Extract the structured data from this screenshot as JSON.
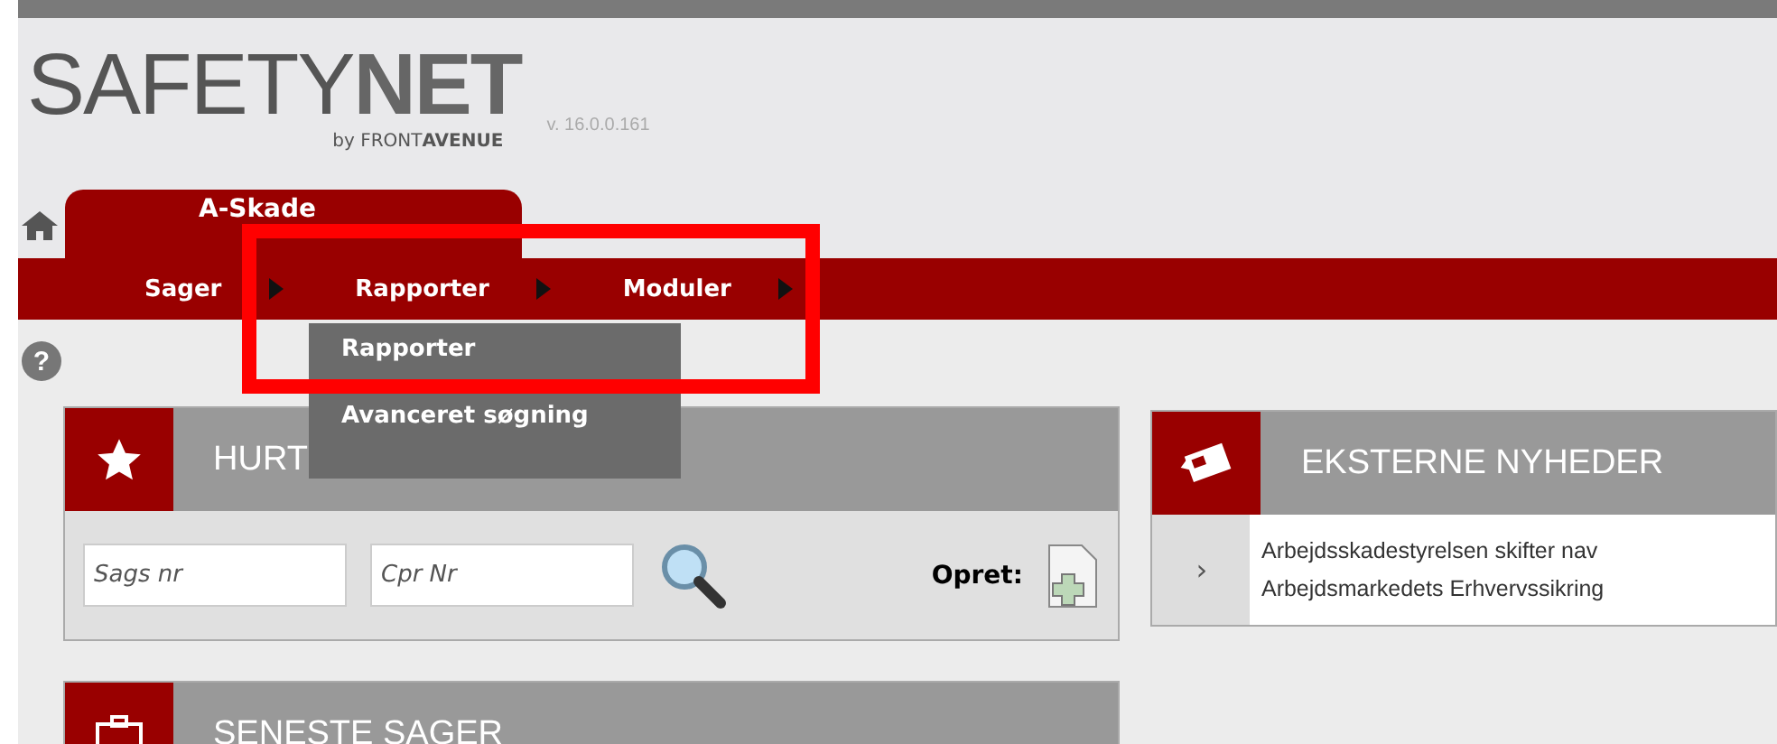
{
  "header": {
    "logo_light": "SAFETY",
    "logo_bold": "NET",
    "version": "v. 16.0.0.161",
    "byline_light": "by FRONT",
    "byline_bold": "AVENUE"
  },
  "tabs": [
    {
      "label": "A-Skade",
      "selected": true
    }
  ],
  "nav": [
    {
      "label": "Sager"
    },
    {
      "label": "Rapporter"
    },
    {
      "label": "Moduler"
    }
  ],
  "dropdown": [
    {
      "label": "Rapporter",
      "selected": false
    },
    {
      "label": "Avanceret søgning",
      "selected": false
    }
  ],
  "quick_search": {
    "title": "HURT",
    "fields": [
      {
        "placeholder": "Sags nr"
      },
      {
        "placeholder": "Cpr Nr"
      }
    ],
    "create_label": "Opret:"
  },
  "news": {
    "title": "EKSTERNE NYHEDER",
    "items": [
      "Arbejdsskadestyrelsen skifter nav",
      "Arbejdsmarkedets Erhvervssikring"
    ]
  },
  "recent": {
    "title": "SENESTE SAGER"
  },
  "help_glyph": "?",
  "news_arrow": "›"
}
